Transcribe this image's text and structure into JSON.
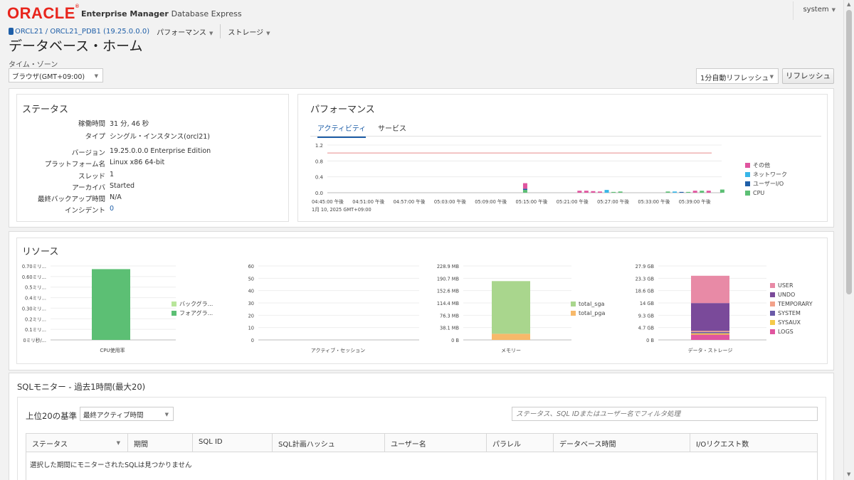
{
  "header": {
    "logo": "ORACLE",
    "logo_mark": "®",
    "product_bold": "Enterprise Manager",
    "product_normal": "Database Express",
    "user": "system"
  },
  "nav": {
    "db_path": "ORCL21 / ORCL21_PDB1 (19.25.0.0.0)",
    "performance_menu": "パフォーマンス",
    "storage_menu": "ストレージ"
  },
  "page": {
    "title": "データベース・ホーム",
    "timezone_label": "タイム・ゾーン",
    "timezone_value": "ブラウザ(GMT+09:00)",
    "refresh_select": "1分自動リフレッシュ",
    "refresh_button": "リフレッシュ"
  },
  "status": {
    "title": "ステータス",
    "rows": [
      {
        "k": "稼働時間",
        "v": "31 分, 46 秒"
      },
      {
        "k": "タイプ",
        "v": "シングル・インスタンス(orcl21)"
      },
      {
        "k": "バージョン",
        "v": "19.25.0.0.0 Enterprise Edition"
      },
      {
        "k": "プラットフォーム名",
        "v": "Linux x86 64-bit"
      },
      {
        "k": "スレッド",
        "v": "1"
      },
      {
        "k": "アーカイバ",
        "v": "Started"
      },
      {
        "k": "最終バックアップ時間",
        "v": "N/A"
      },
      {
        "k": "インシデント",
        "v": "0"
      }
    ]
  },
  "performance": {
    "title": "パフォーマンス",
    "tabs": [
      "アクティビティ",
      "サービス"
    ],
    "x_ticks": [
      "04:45:00 午後",
      "04:51:00 午後",
      "04:57:00 午後",
      "05:03:00 午後",
      "05:09:00 午後",
      "05:15:00 午後",
      "05:21:00 午後",
      "05:27:00 午後",
      "05:33:00 午後",
      "05:39:00 午後"
    ],
    "x_date": "1月 10, 2025 GMT+09:00",
    "y_ticks": [
      "1.2",
      "0.8",
      "0.4",
      "0.0"
    ],
    "legend": [
      {
        "name": "その他",
        "color": "#e0559f"
      },
      {
        "name": "ネットワーク",
        "color": "#38b6e8"
      },
      {
        "name": "ユーザーI/O",
        "color": "#1f5fa8"
      },
      {
        "name": "CPU",
        "color": "#5cbf74"
      }
    ]
  },
  "resources": {
    "title": "リソース",
    "cpu": {
      "title": "CPU使用率",
      "y_ticks": [
        "0.70ミリ...",
        "0.60ミリ...",
        "0.5ミリ...",
        "0.4ミリ...",
        "0.30ミリ...",
        "0.2ミリ...",
        "0.1ミリ...",
        "0ミリ秒/..."
      ],
      "legend": [
        {
          "name": "バックグラ...",
          "color": "#b8e59a"
        },
        {
          "name": "フォアグラ...",
          "color": "#5cbf74"
        }
      ]
    },
    "sessions": {
      "title": "アクティブ・セッション",
      "y_ticks": [
        "60",
        "50",
        "40",
        "30",
        "20",
        "10",
        "0"
      ]
    },
    "memory": {
      "title": "メモリー",
      "y_ticks": [
        "228.9 MB",
        "190.7 MB",
        "152.6 MB",
        "114.4 MB",
        "76.3 MB",
        "38.1 MB",
        "0 B"
      ],
      "legend": [
        {
          "name": "total_sga",
          "color": "#a9d68d"
        },
        {
          "name": "total_pga",
          "color": "#f7b96a"
        }
      ]
    },
    "storage": {
      "title": "データ・ストレージ",
      "y_ticks": [
        "27.9 GB",
        "23.3 GB",
        "18.6 GB",
        "14 GB",
        "9.3 GB",
        "4.7 GB",
        "0 B"
      ],
      "legend": [
        {
          "name": "USER",
          "color": "#e88aa6"
        },
        {
          "name": "UNDO",
          "color": "#7a4a9a"
        },
        {
          "name": "TEMPORARY",
          "color": "#f3a28a"
        },
        {
          "name": "SYSTEM",
          "color": "#6a5aa8"
        },
        {
          "name": "SYSAUX",
          "color": "#f5c94a"
        },
        {
          "name": "LOGS",
          "color": "#e0559f"
        }
      ]
    }
  },
  "chart_data": [
    {
      "type": "bar",
      "title": "",
      "x_ticks": [
        "04:45:00 午後",
        "04:51:00 午後",
        "04:57:00 午後",
        "05:03:00 午後",
        "05:09:00 午後",
        "05:15:00 午後",
        "05:21:00 午後",
        "05:27:00 午後",
        "05:33:00 午後",
        "05:39:00 午後"
      ],
      "ylim": [
        0,
        1.2
      ],
      "series": [
        {
          "name": "その他",
          "points": [
            [
              "05:14",
              0.14
            ],
            [
              "05:22",
              0.05
            ],
            [
              "05:23",
              0.05
            ],
            [
              "05:24",
              0.04
            ],
            [
              "05:25",
              0.03
            ],
            [
              "05:39",
              0.05
            ],
            [
              "05:41",
              0.05
            ]
          ]
        },
        {
          "name": "ネットワーク",
          "points": [
            [
              "05:26",
              0.07
            ],
            [
              "05:36",
              0.03
            ]
          ]
        },
        {
          "name": "ユーザーI/O",
          "points": [
            [
              "05:14",
              0.03
            ],
            [
              "05:37",
              0.02
            ]
          ]
        },
        {
          "name": "CPU",
          "points": [
            [
              "05:14",
              0.07
            ],
            [
              "05:27",
              0.02
            ],
            [
              "05:28",
              0.03
            ],
            [
              "05:35",
              0.03
            ],
            [
              "05:38",
              0.02
            ],
            [
              "05:40",
              0.05
            ],
            [
              "05:43",
              0.08
            ]
          ]
        }
      ]
    },
    {
      "type": "bar",
      "title": "CPU使用率",
      "ylim": [
        0,
        0.7
      ],
      "series": [
        {
          "name": "フォアグラ...",
          "values": [
            0.67
          ]
        },
        {
          "name": "バックグラ...",
          "values": [
            0
          ]
        }
      ]
    },
    {
      "type": "bar",
      "title": "アクティブ・セッション",
      "ylim": [
        0,
        60
      ],
      "series": []
    },
    {
      "type": "bar",
      "title": "メモリー",
      "ylim": [
        0,
        228.9
      ],
      "series": [
        {
          "name": "total_pga",
          "values": [
            19
          ]
        },
        {
          "name": "total_sga",
          "values": [
            163
          ]
        }
      ]
    },
    {
      "type": "bar",
      "title": "データ・ストレージ",
      "ylim": [
        0,
        27.9
      ],
      "series": [
        {
          "name": "LOGS",
          "values": [
            2.0
          ]
        },
        {
          "name": "SYSAUX",
          "values": [
            0.5
          ]
        },
        {
          "name": "SYSTEM",
          "values": [
            0.5
          ]
        },
        {
          "name": "TEMPORARY",
          "values": [
            0.4
          ]
        },
        {
          "name": "UNDO",
          "values": [
            10.5
          ]
        },
        {
          "name": "USER",
          "values": [
            10.3
          ]
        }
      ]
    }
  ],
  "sql_monitor": {
    "title": "SQLモニター - 過去1時間(最大20)",
    "top_label": "上位20の基準",
    "top_select": "最終アクティブ時間",
    "filter_placeholder": "ステータス、SQL IDまたはユーザー名でフィルタ処理",
    "columns": [
      "ステータス",
      "期間",
      "SQL ID",
      "SQL計画ハッシュ",
      "ユーザー名",
      "パラレル",
      "データベース時間",
      "I/Oリクエスト数"
    ],
    "empty_message": "選択した期間にモニターされたSQLは見つかりません"
  }
}
